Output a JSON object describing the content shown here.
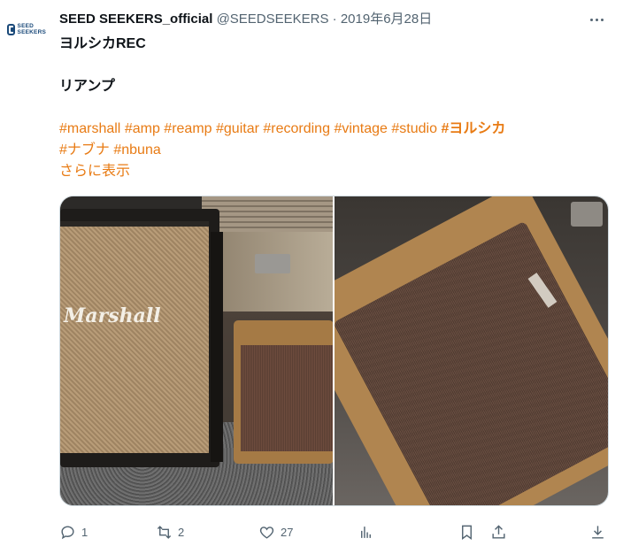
{
  "author": {
    "display_name": "SEED SEEKERS_official",
    "handle": "@SEEDSEEKERS",
    "separator": "·",
    "date": "2019年6月28日",
    "avatar_text_line1": "SEED",
    "avatar_text_line2": "SEEKERS"
  },
  "tweet": {
    "line1": "ヨルシカREC",
    "line2": "リアンプ",
    "hashtags": [
      "#marshall",
      "#amp",
      "#reamp",
      "#guitar",
      "#recording",
      "#vintage",
      "#studio",
      "#ヨルシカ",
      "#ナブナ",
      "#nbuna"
    ],
    "show_more": "さらに表示"
  },
  "media": {
    "left_photo_logo_text": "Marshall",
    "left_photo_icon": "photo-icon",
    "right_photo_icon": "photo-icon"
  },
  "actions": {
    "reply_count": "1",
    "retweet_count": "2",
    "like_count": "27",
    "views_count": "",
    "icons": [
      "reply-icon",
      "retweet-icon",
      "like-icon",
      "views-icon",
      "bookmark-icon",
      "share-icon",
      "download-icon"
    ]
  },
  "colors": {
    "hashtag": "#e87b14",
    "muted": "#536471",
    "text": "#0f1419",
    "brand_logo": "#1b4a7a"
  }
}
